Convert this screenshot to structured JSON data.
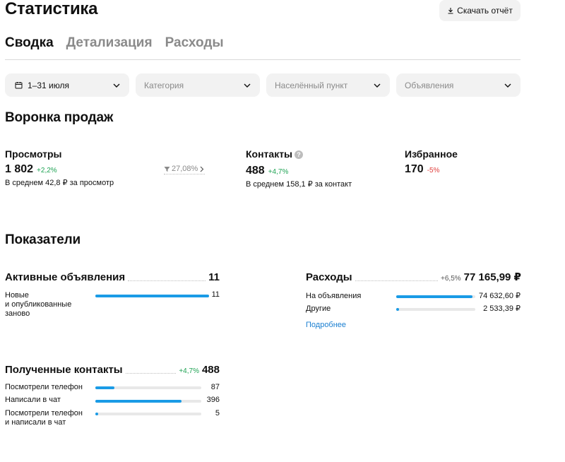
{
  "header": {
    "title": "Статистика",
    "download_label": "Скачать отчёт"
  },
  "tabs": [
    {
      "label": "Сводка",
      "active": true
    },
    {
      "label": "Детализация",
      "active": false
    },
    {
      "label": "Расходы",
      "active": false
    }
  ],
  "filters": {
    "date": "1–31 июля",
    "category": "Категория",
    "city": "Населённый пункт",
    "ads": "Объявления"
  },
  "funnel": {
    "title": "Воронка продаж",
    "views": {
      "label": "Просмотры",
      "value": "1 802",
      "delta": "+2,2%",
      "avg": "В среднем 42,8 ₽ за просмотр"
    },
    "conversion": "27,08%",
    "contacts": {
      "label": "Контакты",
      "value": "488",
      "delta": "+4,7%",
      "avg": "В среднем 158,1 ₽ за контакт"
    },
    "favorites": {
      "label": "Избранное",
      "value": "170",
      "delta": "-5%"
    }
  },
  "indicators": {
    "title": "Показатели",
    "active_ads": {
      "label": "Активные объявления",
      "value": "11",
      "rows": [
        {
          "label": "Новые\nи опубликованные\nзаново",
          "value": "11",
          "share": 1.0
        }
      ]
    },
    "expenses": {
      "label": "Расходы",
      "delta": "+6,5%",
      "value": "77 165,99 ₽",
      "rows": [
        {
          "label": "На объявления",
          "value": "74 632,60 ₽",
          "share": 0.967
        },
        {
          "label": "Другие",
          "value": "2 533,39 ₽",
          "share": 0.033
        }
      ],
      "more_link": "Подробнее"
    },
    "contacts": {
      "label": "Полученные контакты",
      "delta": "+4,7%",
      "value": "488",
      "rows": [
        {
          "label": "Посмотрели телефон",
          "value": "87",
          "share": 0.178
        },
        {
          "label": "Написали в чат",
          "value": "396",
          "share": 0.811
        },
        {
          "label": "Посмотрели телефон\nи написали в чат",
          "value": "5",
          "share": 0.01
        }
      ]
    }
  },
  "colors": {
    "accent_bar": "#1a9be6",
    "positive": "#1fa354",
    "negative": "#e0403e",
    "link": "#1a7fd1"
  }
}
